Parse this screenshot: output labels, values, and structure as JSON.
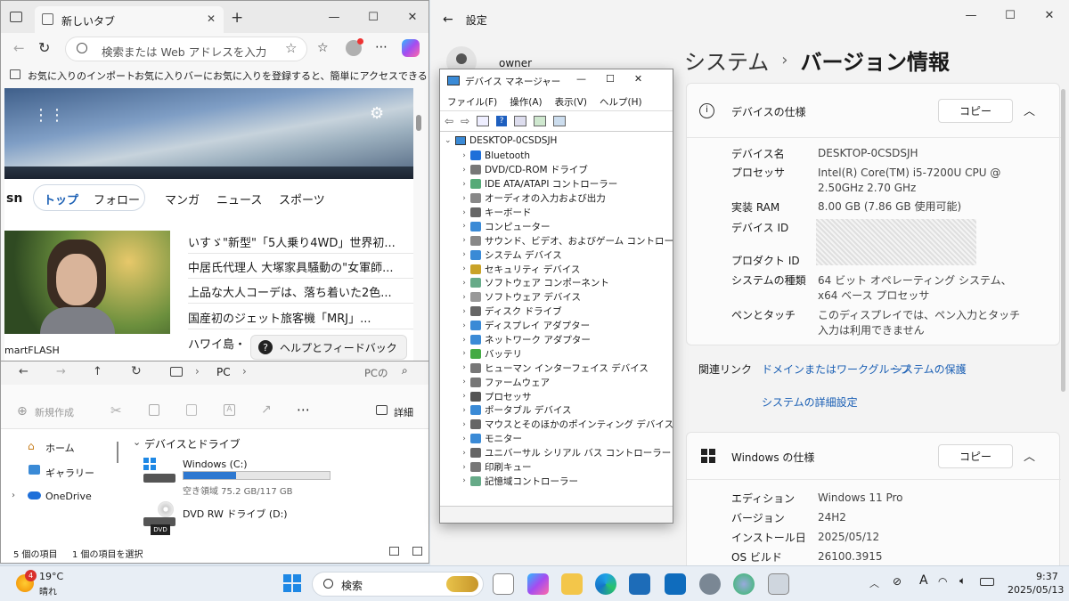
{
  "edge": {
    "tab_title": "新しいタブ",
    "address_placeholder": "検索または Web アドレスを入力",
    "fav1": "お気に入りのインポート",
    "fav2": "お気に入りバーにお気に入りを登録すると、簡単にアクセスできるよ...",
    "msn": "sn",
    "nav": [
      "トップ",
      "フォロー",
      "マンガ",
      "ニュース",
      "スポーツ"
    ],
    "headlines": [
      "いすゞ\"新型\"「5人乗り4WD」世界初...",
      "中居氏代理人 大塚家具騒動の\"女軍師...",
      "上品な大人コーデは、落ち着いた2色...",
      "国産初のジェット旅客機「MRJ」...",
      "ハワイ島・"
    ],
    "photo_source": "martFLASH",
    "help": "ヘルプとフィードバック"
  },
  "explorer": {
    "path": "PC",
    "search": "PCの",
    "new_btn": "新規作成",
    "details": "詳細",
    "sidebar": [
      "ホーム",
      "ギャラリー",
      "OneDrive"
    ],
    "section": "デバイスとドライブ",
    "drives": [
      {
        "name": "Windows (C:)",
        "free": "空き領域 75.2 GB/117 GB",
        "used_fraction": 0.36
      },
      {
        "name": "DVD RW ドライブ (D:)",
        "badge": "DVD"
      }
    ],
    "status": [
      "5 個の項目",
      "1 個の項目を選択"
    ]
  },
  "devmgr": {
    "title": "デバイス マネージャー",
    "menu": [
      "ファイル(F)",
      "操作(A)",
      "表示(V)",
      "ヘルプ(H)"
    ],
    "root": "DESKTOP-0CSDSJH",
    "items": [
      {
        "label": "Bluetooth",
        "color": "#1e6fd9"
      },
      {
        "label": "DVD/CD-ROM ドライブ",
        "color": "#777"
      },
      {
        "label": "IDE ATA/ATAPI コントローラー",
        "color": "#5a7"
      },
      {
        "label": "オーディオの入力および出力",
        "color": "#888"
      },
      {
        "label": "キーボード",
        "color": "#666"
      },
      {
        "label": "コンピューター",
        "color": "#3a8ad6"
      },
      {
        "label": "サウンド、ビデオ、およびゲーム コントローラー",
        "color": "#888"
      },
      {
        "label": "システム デバイス",
        "color": "#3a8ad6"
      },
      {
        "label": "セキュリティ デバイス",
        "color": "#c9a227"
      },
      {
        "label": "ソフトウェア コンポーネント",
        "color": "#6a8"
      },
      {
        "label": "ソフトウェア デバイス",
        "color": "#999"
      },
      {
        "label": "ディスク ドライブ",
        "color": "#666"
      },
      {
        "label": "ディスプレイ アダプター",
        "color": "#3a8ad6"
      },
      {
        "label": "ネットワーク アダプター",
        "color": "#3a8ad6"
      },
      {
        "label": "バッテリ",
        "color": "#4a4"
      },
      {
        "label": "ヒューマン インターフェイス デバイス",
        "color": "#777"
      },
      {
        "label": "ファームウェア",
        "color": "#777"
      },
      {
        "label": "プロセッサ",
        "color": "#555"
      },
      {
        "label": "ポータブル デバイス",
        "color": "#3a8ad6"
      },
      {
        "label": "マウスとそのほかのポインティング デバイス",
        "color": "#666"
      },
      {
        "label": "モニター",
        "color": "#3a8ad6"
      },
      {
        "label": "ユニバーサル シリアル バス コントローラー",
        "color": "#666"
      },
      {
        "label": "印刷キュー",
        "color": "#777"
      },
      {
        "label": "記憶域コントローラー",
        "color": "#6a8"
      }
    ]
  },
  "settings": {
    "app_title": "設定",
    "user": "owner",
    "crumb1": "システム",
    "crumb_sep": "›",
    "crumb2": "バージョン情報",
    "device_spec_title": "デバイスの仕様",
    "copy": "コピー",
    "specs": [
      {
        "label": "デバイス名",
        "value": "DESKTOP-0CSDSJH"
      },
      {
        "label": "プロセッサ",
        "value": "Intel(R) Core(TM) i5-7200U CPU @ 2.50GHz   2.70 GHz"
      },
      {
        "label": "実装 RAM",
        "value": "8.00 GB (7.86 GB 使用可能)"
      },
      {
        "label": "デバイス ID",
        "value": ""
      },
      {
        "label": "プロダクト ID",
        "value": ""
      },
      {
        "label": "システムの種類",
        "value": "64 ビット オペレーティング システム、x64 ベース プロセッサ"
      },
      {
        "label": "ペンとタッチ",
        "value": "このディスプレイでは、ペン入力とタッチ入力は利用できません"
      }
    ],
    "related_links_label": "関連リンク",
    "links": [
      "ドメインまたはワークグループ",
      "システムの保護",
      "システムの詳細設定"
    ],
    "win_spec_title": "Windows の仕様",
    "win_specs": [
      {
        "label": "エディション",
        "value": "Windows 11 Pro"
      },
      {
        "label": "バージョン",
        "value": "24H2"
      },
      {
        "label": "インストール日",
        "value": "2025/05/12"
      },
      {
        "label": "OS ビルド",
        "value": "26100.3915"
      }
    ]
  },
  "taskbar": {
    "weather_temp": "19°C",
    "weather_desc": "晴れ",
    "weather_badge": "4",
    "search": "検索",
    "time": "9:37",
    "date": "2025/05/13",
    "ime": "A"
  }
}
